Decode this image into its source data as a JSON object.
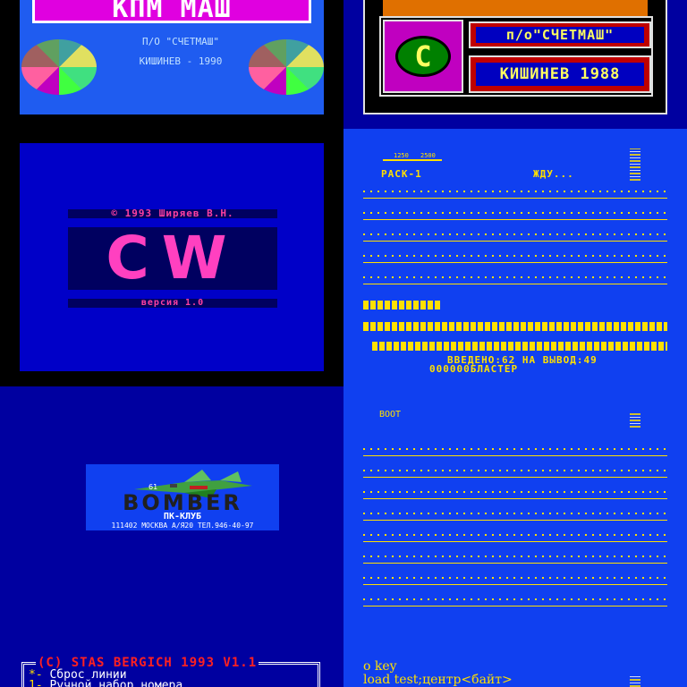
{
  "panel_kpmmash": {
    "banner": "КПМ МАШ",
    "line1": "П/О  \"СЧЕТМАШ\"",
    "line2": "КИШИНЕВ - 1990"
  },
  "panel_schetmash": {
    "logo_letter": "C",
    "org": "п/о\"СЧЕТМАШ\"",
    "city_year": "КИШИНЕВ 1988"
  },
  "panel_cw": {
    "copyright": "© 1993 Ширяев В.Н.",
    "logo": "CW",
    "version": "версия 1.0"
  },
  "panel_rack": {
    "scale_left": "1250",
    "scale_right": "2500",
    "rack": "РАСК-1",
    "status": "ЖДУ...",
    "entered": "ВВЕДЕНО:62   НА ВЫВОД:49",
    "blaster": "000000БЛАСТЕР"
  },
  "panel_bomber": {
    "title": "BOMBER",
    "club": "ПК-КЛУБ",
    "address": "111402 МОСКВА А/Я20  ТЕЛ.946-40-97"
  },
  "panel_boot": {
    "label": "BOOT"
  },
  "panel_stas": {
    "title": "(C) STAS BERGICH  1993  V1.1",
    "menu": [
      {
        "key": "*-",
        "label": " Сброс линии"
      },
      {
        "key": "1-",
        "label": " Ручной набор номера"
      }
    ]
  },
  "panel_load": {
    "line1": "o key",
    "line2": "load test;центр<байт>"
  },
  "colors": {
    "zx_blue": "#0000c8",
    "zx_bright_blue": "#1040f0",
    "zx_yellow": "#ffe000",
    "zx_magenta": "#e000e0"
  }
}
